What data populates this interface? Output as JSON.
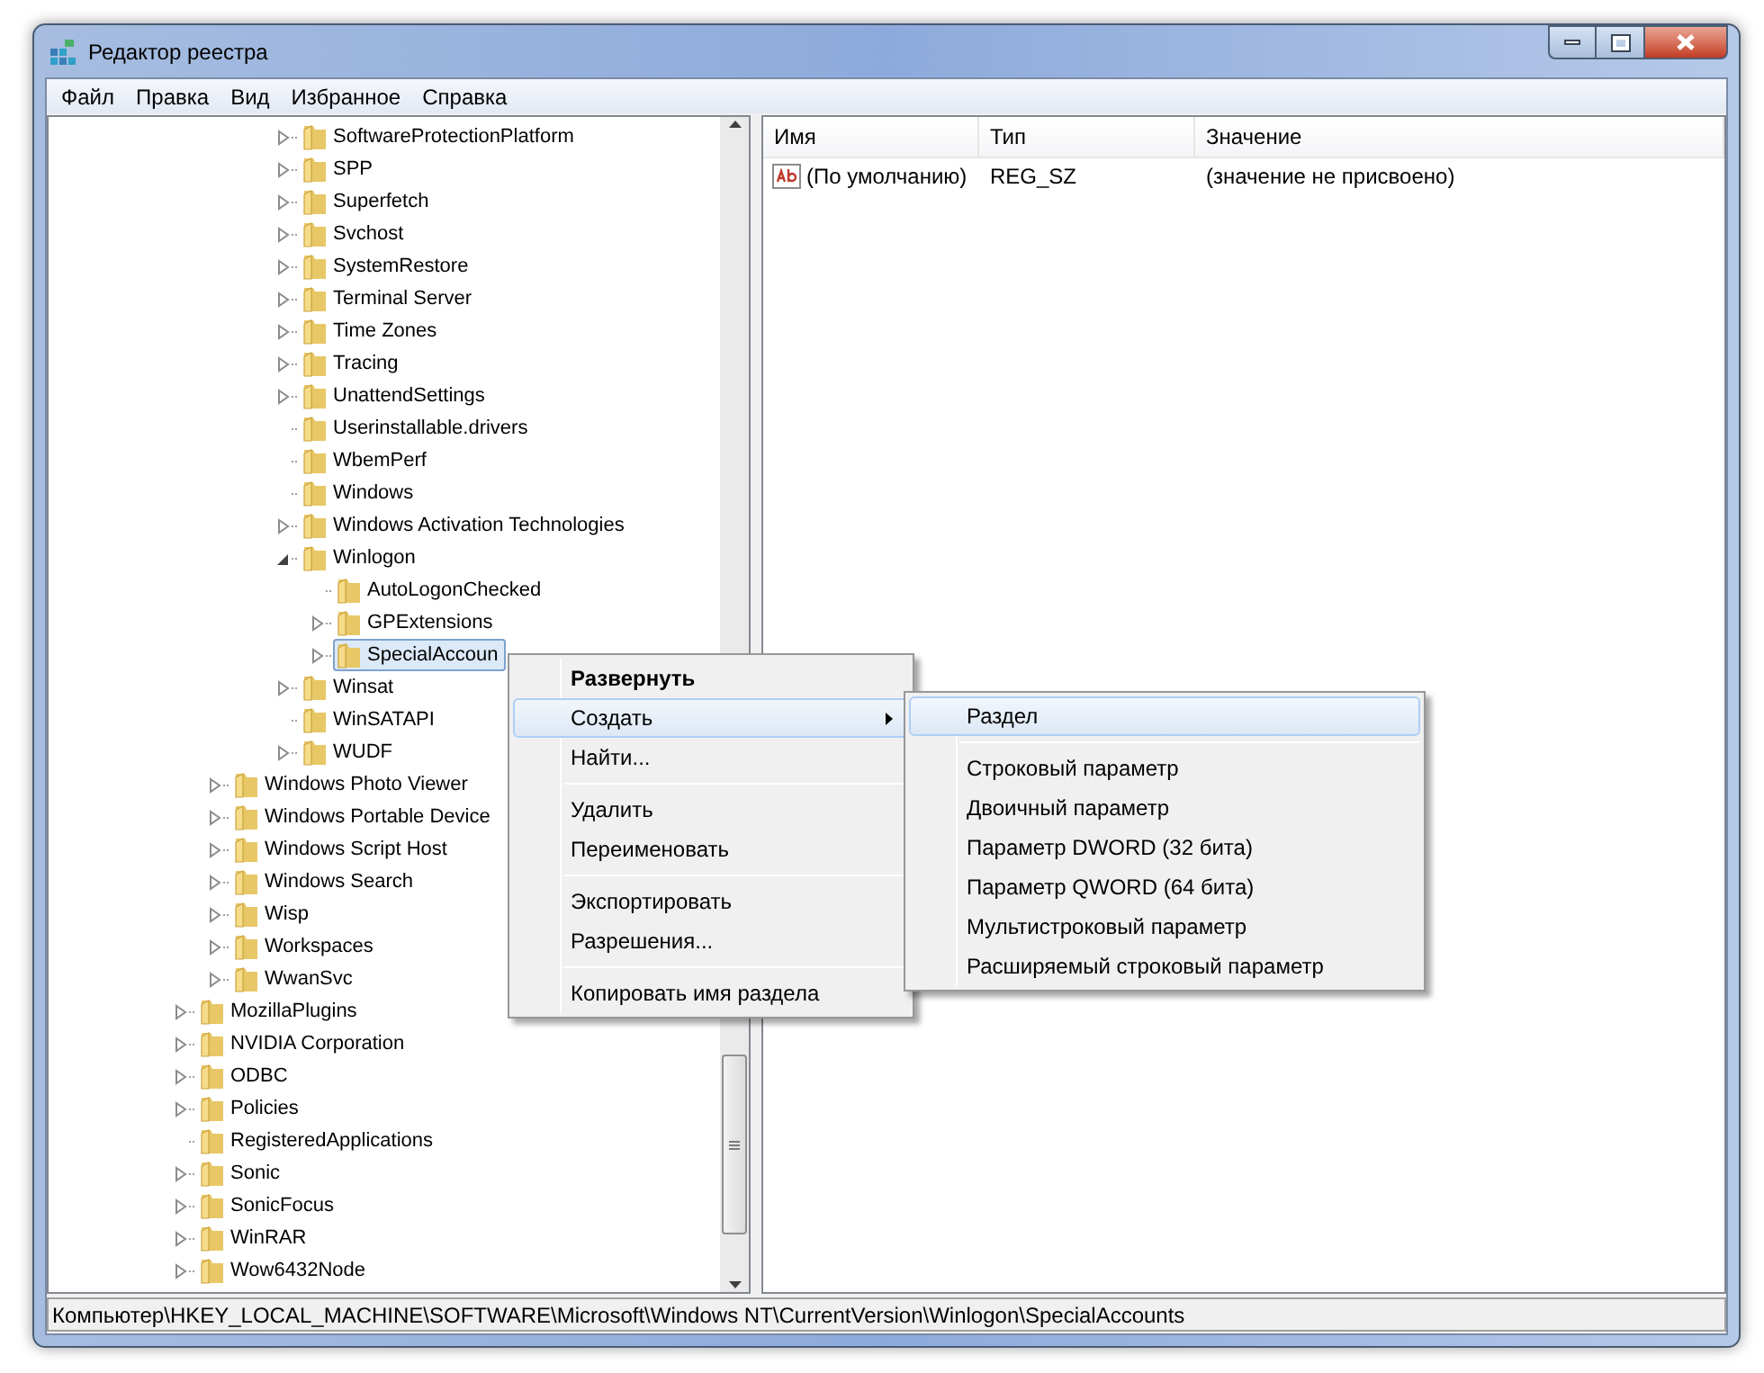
{
  "window": {
    "title": "Редактор реестра"
  },
  "menu": [
    "Файл",
    "Правка",
    "Вид",
    "Избранное",
    "Справка"
  ],
  "tree": [
    {
      "children": [
        {
          "children": [
            {
              "children": [
                {
                  "name": "SoftwareProtectionPlatform",
                  "expanded": false,
                  "selected": false
                },
                {
                  "name": "SPP",
                  "expanded": false,
                  "selected": false
                },
                {
                  "name": "Superfetch",
                  "expanded": false,
                  "selected": false
                },
                {
                  "name": "Svchost",
                  "expanded": false,
                  "selected": false
                },
                {
                  "name": "SystemRestore",
                  "expanded": false,
                  "selected": false
                },
                {
                  "name": "Terminal Server",
                  "expanded": false,
                  "selected": false
                },
                {
                  "name": "Time Zones",
                  "expanded": false,
                  "selected": false
                },
                {
                  "name": "Tracing",
                  "expanded": false,
                  "selected": false
                },
                {
                  "name": "UnattendSettings",
                  "expanded": false,
                  "selected": false
                },
                {
                  "name": "Userinstallable.drivers",
                  "selected": false
                },
                {
                  "name": "WbemPerf",
                  "selected": false
                },
                {
                  "name": "Windows",
                  "selected": false
                },
                {
                  "name": "Windows Activation Technologies",
                  "expanded": false,
                  "selected": false
                },
                {
                  "name": "Winlogon",
                  "expanded": true,
                  "selected": false,
                  "children": [
                    {
                      "name": "AutoLogonChecked",
                      "selected": false
                    },
                    {
                      "name": "GPExtensions",
                      "expanded": false,
                      "selected": false
                    },
                    {
                      "name": "SpecialAccoun",
                      "expanded": false,
                      "selected": true
                    }
                  ]
                },
                {
                  "name": "Winsat",
                  "expanded": false,
                  "selected": false
                },
                {
                  "name": "WinSATAPI",
                  "selected": false
                },
                {
                  "name": "WUDF",
                  "expanded": false,
                  "selected": false
                }
              ]
            }
          ]
        },
        {
          "name": "Windows Photo Viewer",
          "expanded": false,
          "selected": false
        },
        {
          "name": "Windows Portable Device",
          "expanded": false,
          "selected": false
        },
        {
          "name": "Windows Script Host",
          "expanded": false,
          "selected": false
        },
        {
          "name": "Windows Search",
          "expanded": false,
          "selected": false
        },
        {
          "name": "Wisp",
          "expanded": false,
          "selected": false
        },
        {
          "name": "Workspaces",
          "expanded": false,
          "selected": false
        },
        {
          "name": "WwanSvc",
          "expanded": false,
          "selected": false
        }
      ]
    },
    {
      "name": "MozillaPlugins",
      "expanded": false,
      "selected": false
    },
    {
      "name": "NVIDIA Corporation",
      "expanded": false,
      "selected": false
    },
    {
      "name": "ODBC",
      "expanded": false,
      "selected": false
    },
    {
      "name": "Policies",
      "expanded": false,
      "selected": false
    },
    {
      "name": "RegisteredApplications",
      "selected": false
    },
    {
      "name": "Sonic",
      "expanded": false,
      "selected": false
    },
    {
      "name": "SonicFocus",
      "expanded": false,
      "selected": false
    },
    {
      "name": "WinRAR",
      "expanded": false,
      "selected": false
    },
    {
      "name": "Wow6432Node",
      "expanded": false,
      "selected": false
    }
  ],
  "table": {
    "columns": [
      "Имя",
      "Тип",
      "Значение"
    ],
    "rows": [
      [
        "(По умолчанию)",
        "REG_SZ",
        "(значение не присвоено)"
      ]
    ]
  },
  "context_menu": [
    {
      "kind": "item",
      "label": "Развернуть",
      "bold": true,
      "selected": false,
      "submenu": false
    },
    {
      "kind": "item",
      "label": "Создать",
      "bold": false,
      "selected": true,
      "submenu": true
    },
    {
      "kind": "item",
      "label": "Найти...",
      "bold": false,
      "selected": false,
      "submenu": false
    },
    {
      "kind": "separator"
    },
    {
      "kind": "item",
      "label": "Удалить",
      "bold": false,
      "selected": false,
      "submenu": false
    },
    {
      "kind": "item",
      "label": "Переименовать",
      "bold": false,
      "selected": false,
      "submenu": false
    },
    {
      "kind": "separator"
    },
    {
      "kind": "item",
      "label": "Экспортировать",
      "bold": false,
      "selected": false,
      "submenu": false
    },
    {
      "kind": "item",
      "label": "Разрешения...",
      "bold": false,
      "selected": false,
      "submenu": false
    },
    {
      "kind": "separator"
    },
    {
      "kind": "item",
      "label": "Копировать имя раздела",
      "bold": false,
      "selected": false,
      "submenu": false
    }
  ],
  "submenu": [
    {
      "kind": "item",
      "label": "Раздел",
      "selected": true
    },
    {
      "kind": "separator"
    },
    {
      "kind": "item",
      "label": "Строковый параметр",
      "selected": false
    },
    {
      "kind": "item",
      "label": "Двоичный параметр",
      "selected": false
    },
    {
      "kind": "item",
      "label": "Параметр DWORD (32 бита)",
      "selected": false
    },
    {
      "kind": "item",
      "label": "Параметр QWORD (64 бита)",
      "selected": false
    },
    {
      "kind": "item",
      "label": "Мультистроковый параметр",
      "selected": false
    },
    {
      "kind": "item",
      "label": "Расширяемый строковый параметр",
      "selected": false
    }
  ],
  "status_bar": "Компьютер\\HKEY_LOCAL_MACHINE\\SOFTWARE\\Microsoft\\Windows NT\\CurrentVersion\\Winlogon\\SpecialAccounts"
}
